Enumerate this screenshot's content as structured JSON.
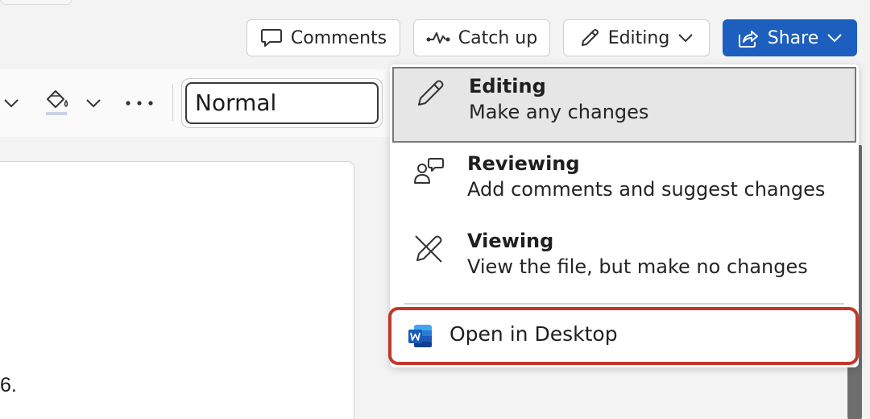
{
  "header": {
    "comments_label": "Comments",
    "catchup_label": "Catch up",
    "editing_label": "Editing",
    "share_label": "Share"
  },
  "toolbar": {
    "style_value": "Normal"
  },
  "document": {
    "visible_text": "6."
  },
  "mode_menu": {
    "items": [
      {
        "title": "Editing",
        "description": "Make any changes",
        "icon": "pencil-icon",
        "selected": true
      },
      {
        "title": "Reviewing",
        "description": "Add comments and suggest changes",
        "icon": "reviewer-icon",
        "selected": false
      },
      {
        "title": "Viewing",
        "description": "View the file, but make no changes",
        "icon": "pencil-off-icon",
        "selected": false
      }
    ],
    "open_desktop_label": "Open in Desktop",
    "open_desktop_icon": "word-app-icon"
  },
  "colors": {
    "share_bg": "#1d5fbf",
    "highlight": "#c0392b",
    "selected_bg": "#e6e6e6"
  }
}
